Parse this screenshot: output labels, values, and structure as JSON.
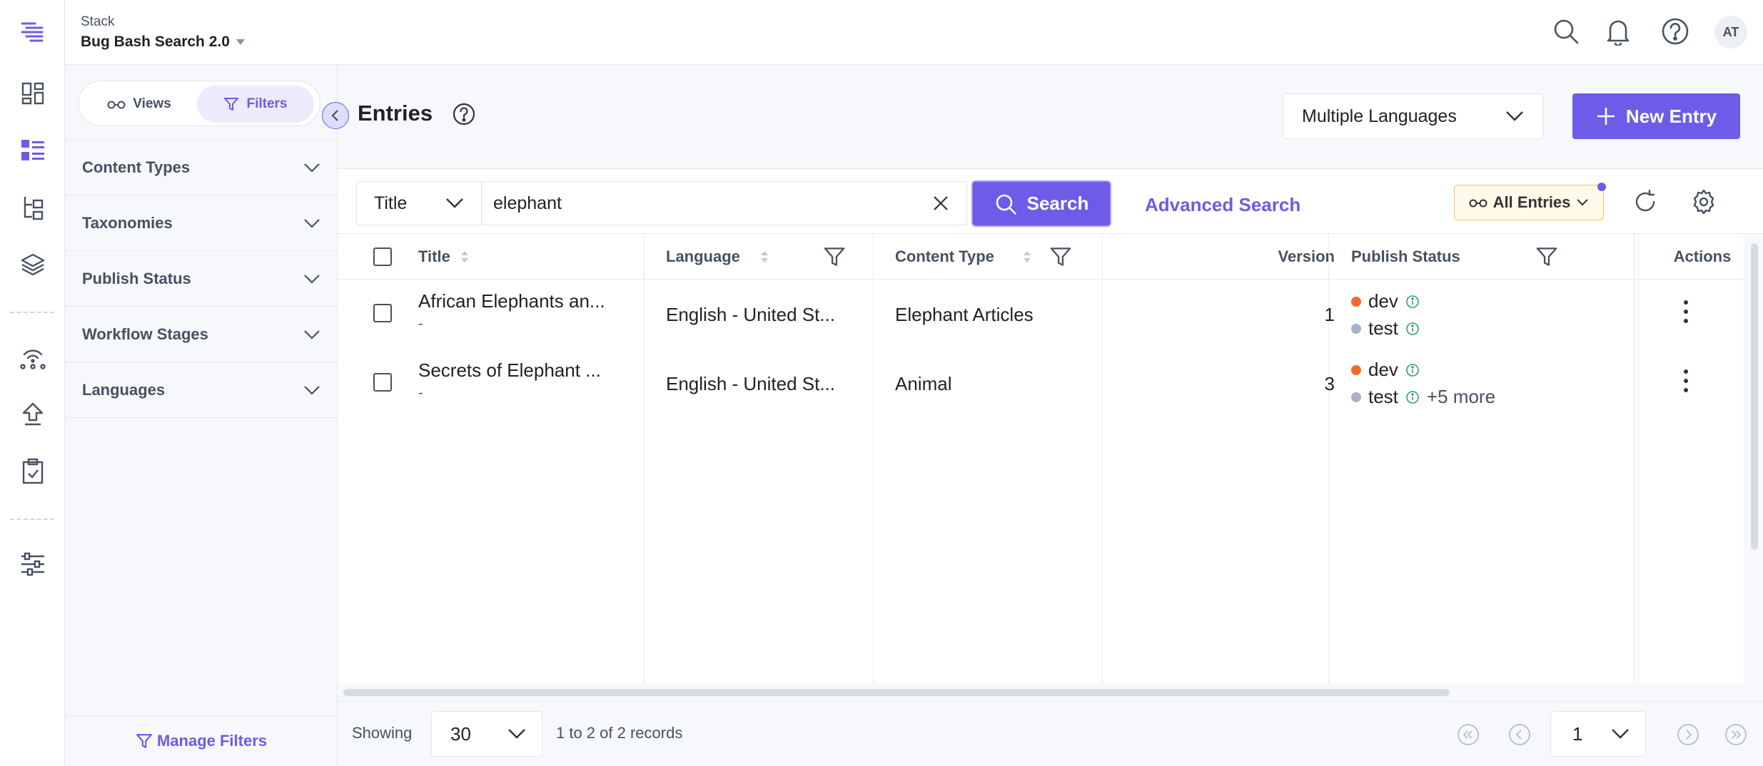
{
  "header": {
    "stack_label": "Stack",
    "stack_name": "Bug Bash Search 2.0",
    "avatar_initials": "AT"
  },
  "panel": {
    "views_label": "Views",
    "filters_label": "Filters",
    "facets": [
      "Content Types",
      "Taxonomies",
      "Publish Status",
      "Workflow Stages",
      "Languages"
    ],
    "manage_filters": "Manage Filters"
  },
  "main": {
    "title": "Entries",
    "language_select": "Multiple Languages",
    "new_entry": "New Entry"
  },
  "search": {
    "field": "Title",
    "query": "elephant",
    "search_button": "Search",
    "advanced": "Advanced Search",
    "all_entries": "All Entries"
  },
  "table": {
    "columns": {
      "title": "Title",
      "language": "Language",
      "content_type": "Content Type",
      "version": "Version",
      "publish_status": "Publish Status",
      "actions": "Actions"
    },
    "rows": [
      {
        "title": "African Elephants an...",
        "sub": "-",
        "language": "English - United St...",
        "content_type": "Elephant Articles",
        "version": "1",
        "status": [
          {
            "env": "dev",
            "color": "#f26b2a"
          },
          {
            "env": "test",
            "color": "#a9b2c6"
          }
        ],
        "more": ""
      },
      {
        "title": "Secrets of Elephant ...",
        "sub": "-",
        "language": "English - United St...",
        "content_type": "Animal",
        "version": "3",
        "status": [
          {
            "env": "dev",
            "color": "#f26b2a"
          },
          {
            "env": "test",
            "color": "#a9b2c6"
          }
        ],
        "more": "+5 more"
      }
    ]
  },
  "footer": {
    "showing": "Showing",
    "per_page": "30",
    "records": "1 to 2 of 2 records",
    "page": "1"
  },
  "colors": {
    "accent": "#6c5ce7",
    "info_green": "#2e9e6b"
  }
}
